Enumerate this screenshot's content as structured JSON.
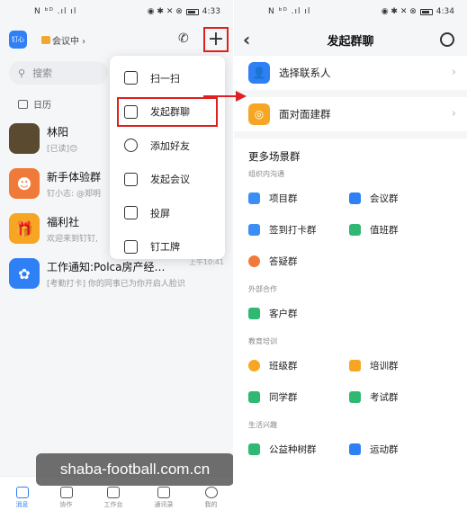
{
  "left": {
    "statusbar": {
      "signal": "N ᵇᴰ .ıl ıl",
      "icons": "◉ ✱ ✕ ⊗",
      "time": "4:33"
    },
    "header": {
      "app_logo": "钉心",
      "meeting_link": "会议中 ›"
    },
    "search": {
      "placeholder": "搜索"
    },
    "tabs": [
      {
        "label": "日历"
      }
    ],
    "chats": [
      {
        "name": "林阳",
        "sub": "[已读]😊",
        "time": "",
        "color": "#5a4a30",
        "icon": ""
      },
      {
        "name": "新手体验群",
        "sub": "钉小志: @郑明",
        "time": "",
        "color": "#f07a3a",
        "icon": "☻"
      },
      {
        "name": "福利社",
        "sub": "欢迎来到钉钉,",
        "time": "",
        "color": "#f6a623",
        "icon": "🎁"
      },
      {
        "name": "工作通知:Polca房产经…",
        "sub": "[考勤打卡] 你的同事已为你开启人脸识",
        "time": "上午10:41",
        "color": "#2f7ff5",
        "icon": "✿"
      }
    ],
    "dropdown": [
      {
        "label": "扫一扫",
        "highlight": false
      },
      {
        "label": "发起群聊",
        "highlight": true
      },
      {
        "label": "添加好友",
        "highlight": false
      },
      {
        "label": "发起会议",
        "highlight": false
      },
      {
        "label": "投屏",
        "highlight": false
      },
      {
        "label": "钉工牌",
        "highlight": false
      }
    ],
    "nav": [
      {
        "label": "消息",
        "active": true
      },
      {
        "label": "协作",
        "active": false
      },
      {
        "label": "工作台",
        "active": false
      },
      {
        "label": "通讯录",
        "active": false
      },
      {
        "label": "我的",
        "active": false
      }
    ],
    "watermark": "shaba-football.com.cn"
  },
  "right": {
    "statusbar": {
      "signal": "N ᵇᴰ .ıl ıl",
      "icons": "◉ ✱ ✕ ⊗",
      "time": "4:34"
    },
    "title": "发起群聊",
    "back": "‹",
    "options": [
      {
        "label": "选择联系人",
        "color": "#2f7ff5",
        "icon": "👤"
      },
      {
        "label": "面对面建群",
        "color": "#f6a623",
        "icon": "◎"
      }
    ],
    "scene_title": "更多场景群",
    "sections": [
      {
        "label": "组织内沟通",
        "items": [
          {
            "label": "项目群",
            "color": "#3a8ef6"
          },
          {
            "label": "会议群",
            "color": "#2f7ff5"
          },
          {
            "label": "签到打卡群",
            "color": "#3a8ef6"
          },
          {
            "label": "值班群",
            "color": "#2eb872"
          },
          {
            "label": "答疑群",
            "color": "#f07a3a"
          }
        ]
      },
      {
        "label": "外部合作",
        "items": [
          {
            "label": "客户群",
            "color": "#2eb872"
          }
        ]
      },
      {
        "label": "教育培训",
        "items": [
          {
            "label": "班级群",
            "color": "#f6a623"
          },
          {
            "label": "培训群",
            "color": "#f6a623"
          },
          {
            "label": "同学群",
            "color": "#2eb872"
          },
          {
            "label": "考试群",
            "color": "#2eb872"
          }
        ]
      },
      {
        "label": "生活兴趣",
        "items": [
          {
            "label": "公益种树群",
            "color": "#2eb872"
          },
          {
            "label": "运动群",
            "color": "#2f7ff5"
          }
        ]
      }
    ]
  }
}
